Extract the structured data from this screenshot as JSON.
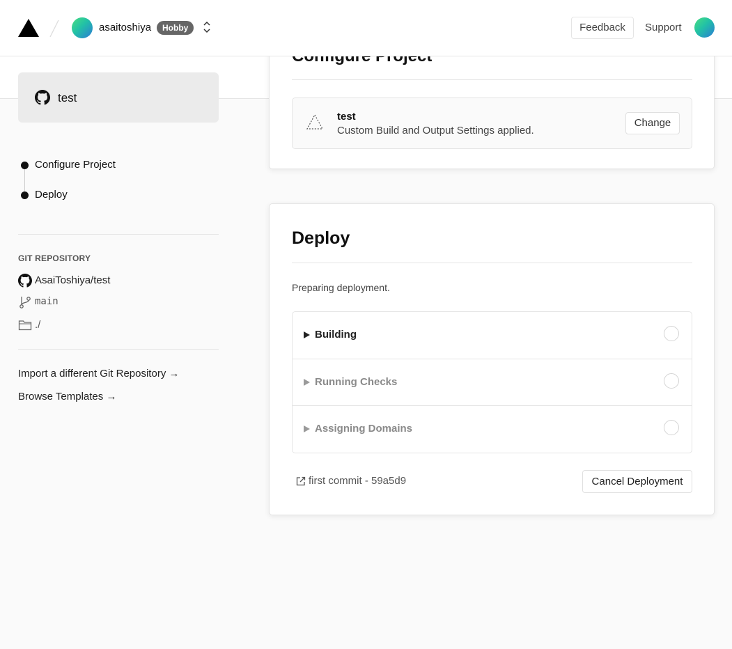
{
  "header": {
    "team_name": "asaitoshiya",
    "plan_badge": "Hobby",
    "feedback_label": "Feedback",
    "support_label": "Support"
  },
  "sidebar": {
    "repo_card_name": "test",
    "steps": [
      {
        "label": "Configure Project"
      },
      {
        "label": "Deploy"
      }
    ],
    "git_heading": "GIT REPOSITORY",
    "repo_full_name": "AsaiToshiya/test",
    "branch": "main",
    "root_dir": "./",
    "import_link": "Import a different Git Repository →",
    "templates_link": "Browse Templates →"
  },
  "configure": {
    "title": "Configure Project",
    "project_name": "test",
    "project_desc": "Custom Build and Output Settings applied.",
    "change_label": "Change"
  },
  "deploy": {
    "title": "Deploy",
    "status": "Preparing deployment.",
    "steps": [
      {
        "label": "Building",
        "color": "#222222"
      },
      {
        "label": "Running Checks",
        "color": "#8a8a8a"
      },
      {
        "label": "Assigning Domains",
        "color": "#8a8a8a"
      }
    ],
    "commit_text": "first commit - 59a5d9",
    "cancel_label": "Cancel Deployment"
  }
}
